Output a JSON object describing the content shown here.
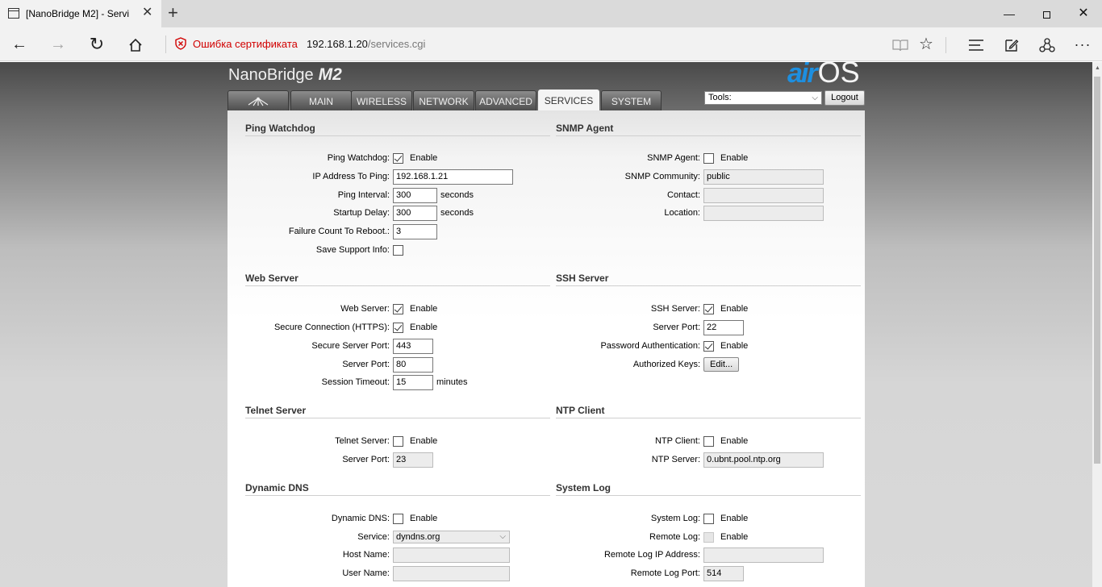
{
  "browser": {
    "tab_title": "[NanoBridge M2] - Servi",
    "cert_warning": "Ошибка сертификата",
    "url_host": "192.168.1.20",
    "url_path": "/services.cgi"
  },
  "header": {
    "device_name": "NanoBridge",
    "device_model": "M2",
    "brand_air": "air",
    "brand_os": "OS",
    "tools_label": "Tools:",
    "logout_label": "Logout"
  },
  "tabs": [
    {
      "label": "",
      "icon": "ubnt-logo-icon"
    },
    {
      "label": "MAIN"
    },
    {
      "label": "WIRELESS"
    },
    {
      "label": "NETWORK"
    },
    {
      "label": "ADVANCED"
    },
    {
      "label": "SERVICES",
      "active": true
    },
    {
      "label": "SYSTEM"
    }
  ],
  "common": {
    "enable": "Enable",
    "seconds": "seconds",
    "minutes": "minutes"
  },
  "ping_watchdog": {
    "title": "Ping Watchdog",
    "enable_label": "Ping Watchdog:",
    "enabled": true,
    "ip_label": "IP Address To Ping:",
    "ip_value": "192.168.1.21",
    "interval_label": "Ping Interval:",
    "interval_value": "300",
    "startup_label": "Startup Delay:",
    "startup_value": "300",
    "failure_label": "Failure Count To Reboot.:",
    "failure_value": "3",
    "support_label": "Save Support Info:",
    "support_checked": false
  },
  "snmp": {
    "title": "SNMP Agent",
    "enable_label": "SNMP Agent:",
    "enabled": false,
    "community_label": "SNMP Community:",
    "community_value": "public",
    "contact_label": "Contact:",
    "contact_value": "",
    "location_label": "Location:",
    "location_value": ""
  },
  "web_server": {
    "title": "Web Server",
    "enable_label": "Web Server:",
    "enabled": true,
    "https_label": "Secure Connection (HTTPS):",
    "https_enabled": true,
    "secure_port_label": "Secure Server Port:",
    "secure_port_value": "443",
    "port_label": "Server Port:",
    "port_value": "80",
    "timeout_label": "Session Timeout:",
    "timeout_value": "15"
  },
  "ssh_server": {
    "title": "SSH Server",
    "enable_label": "SSH Server:",
    "enabled": true,
    "port_label": "Server Port:",
    "port_value": "22",
    "password_label": "Password Authentication:",
    "password_enabled": true,
    "keys_label": "Authorized Keys:",
    "keys_button": "Edit..."
  },
  "telnet_server": {
    "title": "Telnet Server",
    "enable_label": "Telnet Server:",
    "enabled": false,
    "port_label": "Server Port:",
    "port_value": "23"
  },
  "ntp_client": {
    "title": "NTP Client",
    "enable_label": "NTP Client:",
    "enabled": false,
    "server_label": "NTP Server:",
    "server_value": "0.ubnt.pool.ntp.org"
  },
  "dynamic_dns": {
    "title": "Dynamic DNS",
    "enable_label": "Dynamic DNS:",
    "enabled": false,
    "service_label": "Service:",
    "service_value": "dyndns.org",
    "host_label": "Host Name:",
    "host_value": "",
    "user_label": "User Name:",
    "user_value": ""
  },
  "system_log": {
    "title": "System Log",
    "enable_label": "System Log:",
    "enabled": false,
    "remote_label": "Remote Log:",
    "remote_enabled": false,
    "remote_ip_label": "Remote Log IP Address:",
    "remote_ip_value": "",
    "remote_port_label": "Remote Log Port:",
    "remote_port_value": "514"
  }
}
